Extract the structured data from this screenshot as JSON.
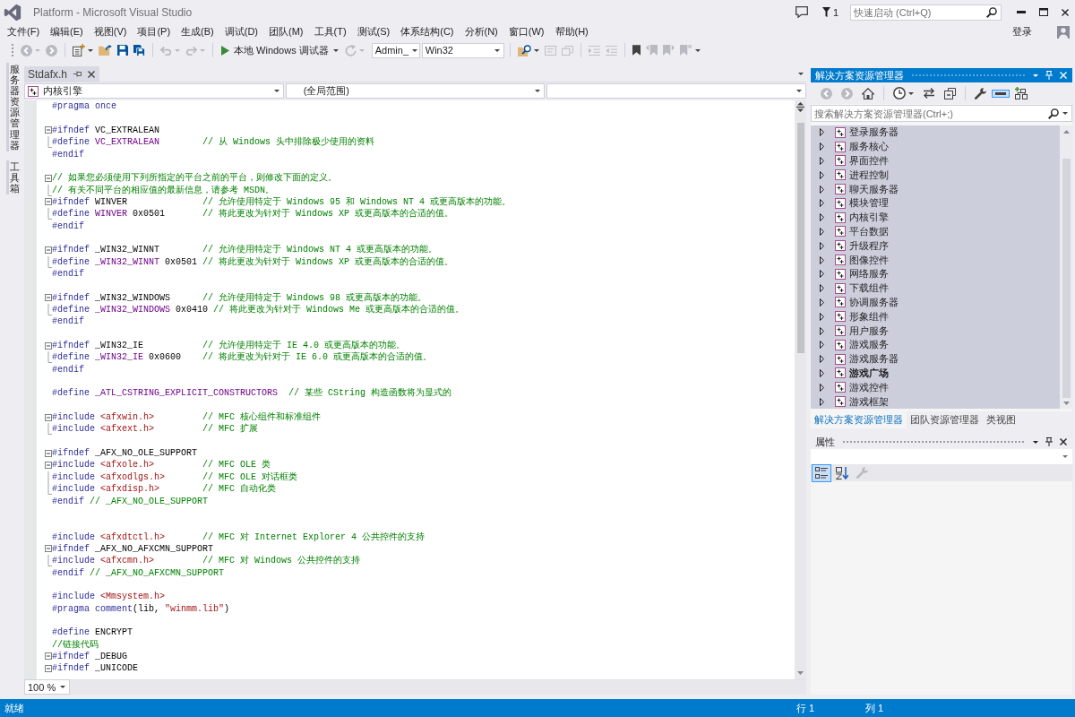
{
  "title_bar": {
    "title": "Platform - Microsoft Visual Studio",
    "notification_count": "1",
    "quick_launch": {
      "placeholder": "快速启动 (Ctrl+Q)"
    }
  },
  "menu_bar": {
    "items": [
      "文件(F)",
      "编辑(E)",
      "视图(V)",
      "项目(P)",
      "生成(B)",
      "调试(D)",
      "团队(M)",
      "工具(T)",
      "测试(S)",
      "体系结构(C)",
      "分析(N)",
      "窗口(W)",
      "帮助(H)"
    ],
    "sign_in": "登录"
  },
  "toolbar": {
    "buttons": [
      {
        "disabled": true
      },
      {
        "disabled": true
      },
      {
        "disabled": false
      },
      {
        "disabled": false
      },
      {
        "disabled": false
      },
      {
        "disabled": false
      },
      {
        "disabled": true
      },
      {
        "disabled": true
      },
      {
        "disabled": true
      },
      {
        "disabled": false
      },
      {
        "disabled": true
      },
      {
        "disabled": true
      },
      {
        "disabled": true
      },
      {
        "disabled": true
      },
      {
        "disabled": false
      },
      {
        "disabled": true
      },
      {
        "disabled": true
      },
      {
        "disabled": true
      }
    ],
    "debugger": {
      "label": "本地 Windows 调试器"
    },
    "configuration": {
      "value": "Admin_"
    },
    "platform": {
      "value": "Win32"
    }
  },
  "side_tabs": [
    "服务器资源管理器",
    "工具箱"
  ],
  "editor": {
    "tabs": [
      {
        "label": "Stdafx.h",
        "selected": true
      }
    ],
    "navigation": {
      "project": "内核引擎",
      "scope": "(全局范围)"
    },
    "lines": [
      {
        "kind": "code",
        "segments": [
          {
            "kind": "directive",
            "text": "#pragma once"
          }
        ]
      },
      {
        "kind": "blank"
      },
      {
        "kind": "code",
        "collapsible": true,
        "segments": [
          {
            "kind": "directive",
            "text": "#ifndef"
          },
          {
            "kind": "plain",
            "text": " VC_EXTRALEAN"
          }
        ]
      },
      {
        "kind": "code",
        "block_end": true,
        "segments": [
          {
            "kind": "directive",
            "text": "#define"
          },
          {
            "kind": "macro",
            "text": " VC_EXTRALEAN"
          },
          {
            "kind": "comment",
            "text": "        // 从 Windows 头中排除极少使用的资料"
          }
        ]
      },
      {
        "kind": "code",
        "segments": [
          {
            "kind": "directive",
            "text": "#endif"
          }
        ]
      },
      {
        "kind": "blank"
      },
      {
        "kind": "code",
        "collapsible": true,
        "segments": [
          {
            "kind": "comment",
            "text": "// 如果您必须使用下列所指定的平台之前的平台，则修改下面的定义。"
          }
        ]
      },
      {
        "kind": "code",
        "block_end": true,
        "segments": [
          {
            "kind": "comment",
            "text": "// 有关不同平台的相应值的最新信息，请参考 MSDN。"
          }
        ]
      },
      {
        "kind": "code",
        "collapsible": true,
        "segments": [
          {
            "kind": "directive",
            "text": "#ifndef"
          },
          {
            "kind": "plain",
            "text": " WINVER"
          },
          {
            "kind": "comment",
            "text": "              // 允许使用特定于 Windows 95 和 Windows NT 4 或更高版本的功能。"
          }
        ]
      },
      {
        "kind": "code",
        "block_end": true,
        "segments": [
          {
            "kind": "directive",
            "text": "#define"
          },
          {
            "kind": "macro",
            "text": " WINVER"
          },
          {
            "kind": "plain",
            "text": " 0x0501"
          },
          {
            "kind": "comment",
            "text": "       // 将此更改为针对于 Windows XP 或更高版本的合适的值。"
          }
        ]
      },
      {
        "kind": "code",
        "segments": [
          {
            "kind": "directive",
            "text": "#endif"
          }
        ]
      },
      {
        "kind": "blank"
      },
      {
        "kind": "code",
        "collapsible": true,
        "segments": [
          {
            "kind": "directive",
            "text": "#ifndef"
          },
          {
            "kind": "plain",
            "text": " _WIN32_WINNT"
          },
          {
            "kind": "comment",
            "text": "        // 允许使用特定于 Windows NT 4 或更高版本的功能。"
          }
        ]
      },
      {
        "kind": "code",
        "block_end": true,
        "segments": [
          {
            "kind": "directive",
            "text": "#define"
          },
          {
            "kind": "macro",
            "text": " _WIN32_WINNT"
          },
          {
            "kind": "plain",
            "text": " 0x0501"
          },
          {
            "kind": "comment",
            "text": " // 将此更改为针对于 Windows XP 或更高版本的合适的值。"
          }
        ]
      },
      {
        "kind": "code",
        "segments": [
          {
            "kind": "directive",
            "text": "#endif"
          }
        ]
      },
      {
        "kind": "blank"
      },
      {
        "kind": "code",
        "collapsible": true,
        "segments": [
          {
            "kind": "directive",
            "text": "#ifndef"
          },
          {
            "kind": "plain",
            "text": " _WIN32_WINDOWS"
          },
          {
            "kind": "comment",
            "text": "      // 允许使用特定于 Windows 98 或更高版本的功能。"
          }
        ]
      },
      {
        "kind": "code",
        "block_end": true,
        "segments": [
          {
            "kind": "directive",
            "text": "#define"
          },
          {
            "kind": "macro",
            "text": " _WIN32_WINDOWS"
          },
          {
            "kind": "plain",
            "text": " 0x0410"
          },
          {
            "kind": "comment",
            "text": " // 将此更改为针对于 Windows Me 或更高版本的合适的值。"
          }
        ]
      },
      {
        "kind": "code",
        "segments": [
          {
            "kind": "directive",
            "text": "#endif"
          }
        ]
      },
      {
        "kind": "blank"
      },
      {
        "kind": "code",
        "collapsible": true,
        "segments": [
          {
            "kind": "directive",
            "text": "#ifndef"
          },
          {
            "kind": "plain",
            "text": " _WIN32_IE"
          },
          {
            "kind": "comment",
            "text": "           // 允许使用特定于 IE 4.0 或更高版本的功能。"
          }
        ]
      },
      {
        "kind": "code",
        "block_end": true,
        "segments": [
          {
            "kind": "directive",
            "text": "#define"
          },
          {
            "kind": "macro",
            "text": " _WIN32_IE"
          },
          {
            "kind": "plain",
            "text": " 0x0600"
          },
          {
            "kind": "comment",
            "text": "    // 将此更改为针对于 IE 6.0 或更高版本的合适的值。"
          }
        ]
      },
      {
        "kind": "code",
        "segments": [
          {
            "kind": "directive",
            "text": "#endif"
          }
        ]
      },
      {
        "kind": "blank"
      },
      {
        "kind": "code",
        "segments": [
          {
            "kind": "directive",
            "text": "#define"
          },
          {
            "kind": "macro",
            "text": " _ATL_CSTRING_EXPLICIT_CONSTRUCTORS"
          },
          {
            "kind": "comment",
            "text": "  // 某些 CString 构造函数将为显式的"
          }
        ]
      },
      {
        "kind": "blank"
      },
      {
        "kind": "code",
        "collapsible": true,
        "segments": [
          {
            "kind": "directive",
            "text": "#include"
          },
          {
            "kind": "string",
            "text": " <afxwin.h>"
          },
          {
            "kind": "comment",
            "text": "         // MFC 核心组件和标准组件"
          }
        ]
      },
      {
        "kind": "code",
        "block_end": true,
        "segments": [
          {
            "kind": "directive",
            "text": "#include"
          },
          {
            "kind": "string",
            "text": " <afxext.h>"
          },
          {
            "kind": "comment",
            "text": "         // MFC 扩展"
          }
        ]
      },
      {
        "kind": "blank"
      },
      {
        "kind": "code",
        "collapsible": true,
        "segments": [
          {
            "kind": "directive",
            "text": "#ifndef"
          },
          {
            "kind": "plain",
            "text": " _AFX_NO_OLE_SUPPORT"
          }
        ]
      },
      {
        "kind": "code",
        "collapsible": true,
        "segments": [
          {
            "kind": "directive",
            "text": "#include"
          },
          {
            "kind": "string",
            "text": " <afxole.h>"
          },
          {
            "kind": "comment",
            "text": "         // MFC OLE 类"
          }
        ]
      },
      {
        "kind": "code",
        "nested": true,
        "segments": [
          {
            "kind": "directive",
            "text": "#include"
          },
          {
            "kind": "string",
            "text": " <afxodlgs.h>"
          },
          {
            "kind": "comment",
            "text": "       // MFC OLE 对话框类"
          }
        ]
      },
      {
        "kind": "code",
        "block_end": true,
        "segments": [
          {
            "kind": "directive",
            "text": "#include"
          },
          {
            "kind": "string",
            "text": " <afxdisp.h>"
          },
          {
            "kind": "comment",
            "text": "        // MFC 自动化类"
          }
        ]
      },
      {
        "kind": "code",
        "segments": [
          {
            "kind": "directive",
            "text": "#endif"
          },
          {
            "kind": "comment",
            "text": " // _AFX_NO_OLE_SUPPORT"
          }
        ]
      },
      {
        "kind": "blank"
      },
      {
        "kind": "blank"
      },
      {
        "kind": "code",
        "segments": [
          {
            "kind": "directive",
            "text": "#include"
          },
          {
            "kind": "string",
            "text": " <afxdtctl.h>"
          },
          {
            "kind": "comment",
            "text": "       // MFC 对 Internet Explorer 4 公共控件的支持"
          }
        ]
      },
      {
        "kind": "code",
        "collapsible": true,
        "segments": [
          {
            "kind": "directive",
            "text": "#ifndef"
          },
          {
            "kind": "plain",
            "text": " _AFX_NO_AFXCMN_SUPPORT"
          }
        ]
      },
      {
        "kind": "code",
        "block_end": true,
        "segments": [
          {
            "kind": "directive",
            "text": "#include"
          },
          {
            "kind": "string",
            "text": " <afxcmn.h>"
          },
          {
            "kind": "comment",
            "text": "         // MFC 对 Windows 公共控件的支持"
          }
        ]
      },
      {
        "kind": "code",
        "segments": [
          {
            "kind": "directive",
            "text": "#endif"
          },
          {
            "kind": "comment",
            "text": " // _AFX_NO_AFXCMN_SUPPORT"
          }
        ]
      },
      {
        "kind": "blank"
      },
      {
        "kind": "code",
        "segments": [
          {
            "kind": "directive",
            "text": "#include"
          },
          {
            "kind": "string",
            "text": " <Mmsystem.h>"
          }
        ]
      },
      {
        "kind": "code",
        "segments": [
          {
            "kind": "directive",
            "text": "#pragma comment"
          },
          {
            "kind": "plain",
            "text": "(lib, "
          },
          {
            "kind": "string",
            "text": "\"winmm.lib\""
          },
          {
            "kind": "plain",
            "text": ")"
          }
        ]
      },
      {
        "kind": "blank"
      },
      {
        "kind": "code",
        "segments": [
          {
            "kind": "directive",
            "text": "#define"
          },
          {
            "kind": "plain",
            "text": " ENCRYPT"
          }
        ]
      },
      {
        "kind": "code",
        "segments": [
          {
            "kind": "comment",
            "text": "//链接代码"
          }
        ]
      },
      {
        "kind": "code",
        "collapsible": true,
        "segments": [
          {
            "kind": "directive",
            "text": "#ifndef"
          },
          {
            "kind": "plain",
            "text": " _DEBUG"
          }
        ]
      },
      {
        "kind": "code",
        "collapsible": true,
        "segments": [
          {
            "kind": "directive",
            "text": "#ifndef"
          },
          {
            "kind": "plain",
            "text": " _UNICODE"
          }
        ]
      }
    ],
    "zoom": "100 %"
  },
  "solution_explorer": {
    "title": "解决方案资源管理器",
    "toolbar": [
      {
        "selected": false,
        "disabled": true
      },
      {
        "selected": false,
        "disabled": true
      },
      {
        "selected": false,
        "disabled": false
      },
      {
        "selected": false,
        "disabled": false
      },
      {
        "selected": false,
        "disabled": false
      },
      {
        "selected": false,
        "disabled": false
      },
      {
        "selected": false,
        "disabled": false
      },
      {
        "selected": true,
        "disabled": false
      },
      {
        "selected": false,
        "disabled": false
      }
    ],
    "search": {
      "placeholder": "搜索解决方案资源管理器(Ctrl+;)"
    },
    "items": [
      {
        "label": "登录服务器",
        "expanded": false,
        "selected": true,
        "startup": false
      },
      {
        "label": "服务核心",
        "expanded": false,
        "selected": true,
        "startup": false
      },
      {
        "label": "界面控件",
        "expanded": false,
        "selected": true,
        "startup": false
      },
      {
        "label": "进程控制",
        "expanded": false,
        "selected": true,
        "startup": false
      },
      {
        "label": "聊天服务器",
        "expanded": false,
        "selected": true,
        "startup": false
      },
      {
        "label": "模块管理",
        "expanded": false,
        "selected": true,
        "startup": false
      },
      {
        "label": "内核引擎",
        "expanded": false,
        "selected": true,
        "startup": false
      },
      {
        "label": "平台数据",
        "expanded": false,
        "selected": true,
        "startup": false
      },
      {
        "label": "升级程序",
        "expanded": false,
        "selected": true,
        "startup": false
      },
      {
        "label": "图像控件",
        "expanded": false,
        "selected": true,
        "startup": false
      },
      {
        "label": "网络服务",
        "expanded": false,
        "selected": true,
        "startup": false
      },
      {
        "label": "下载组件",
        "expanded": false,
        "selected": true,
        "startup": false
      },
      {
        "label": "协调服务器",
        "expanded": false,
        "selected": true,
        "startup": false
      },
      {
        "label": "形象组件",
        "expanded": false,
        "selected": true,
        "startup": false
      },
      {
        "label": "用户服务",
        "expanded": false,
        "selected": true,
        "startup": false
      },
      {
        "label": "游戏服务",
        "expanded": false,
        "selected": true,
        "startup": false
      },
      {
        "label": "游戏服务器",
        "expanded": false,
        "selected": true,
        "startup": false
      },
      {
        "label": "游戏广场",
        "expanded": false,
        "selected": true,
        "startup": true
      },
      {
        "label": "游戏控件",
        "expanded": false,
        "selected": true,
        "startup": false
      },
      {
        "label": "游戏框架",
        "expanded": false,
        "selected": true,
        "startup": false
      }
    ],
    "tabs": [
      {
        "label": "解决方案资源管理器",
        "selected": true
      },
      {
        "label": "团队资源管理器",
        "selected": false
      },
      {
        "label": "类视图",
        "selected": false
      }
    ]
  },
  "properties": {
    "title": "属性",
    "toolbar": [
      {
        "selected": true,
        "disabled": false
      },
      {
        "selected": false,
        "disabled": false
      },
      {
        "selected": false,
        "disabled": true
      }
    ]
  },
  "status_bar": {
    "message": "就绪",
    "line": "行 1",
    "column": "列 1"
  }
}
